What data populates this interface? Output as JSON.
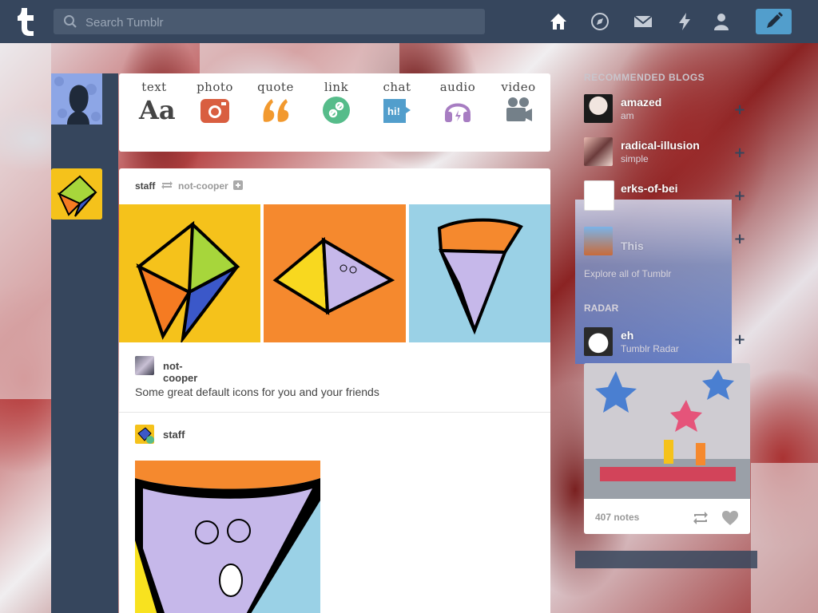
{
  "topbar": {
    "search_placeholder": "Search Tumblr",
    "icons": [
      "home-icon",
      "explore-icon",
      "inbox-icon",
      "activity-icon",
      "account-icon",
      "compose-icon"
    ]
  },
  "post_types": [
    {
      "label": "text",
      "glyph": "Aa",
      "color": "#444444"
    },
    {
      "label": "photo",
      "color": "#d95e40"
    },
    {
      "label": "quote",
      "glyph": "❝",
      "color": "#f2992e"
    },
    {
      "label": "link",
      "color": "#56bc8a"
    },
    {
      "label": "chat",
      "glyph": "hi!",
      "color": "#529ecc"
    },
    {
      "label": "audio",
      "color": "#a77dc2"
    },
    {
      "label": "video",
      "color": "#748089"
    }
  ],
  "post": {
    "author": "staff",
    "reblogged_from": "not-cooper",
    "reblog_user": "not-cooper",
    "text": "Some great default icons for you and your friends",
    "second_user": "staff"
  },
  "sidebar": {
    "recommended_title": "RECOMMENDED BLOGS",
    "blogs": [
      {
        "name": "amazed",
        "sub": "am"
      },
      {
        "name": "radical-illusion",
        "sub": "simple"
      },
      {
        "name": "erks-of-bei",
        "sub": ""
      },
      {
        "name": "This",
        "sub": ""
      }
    ],
    "explore_text": "Explore all of Tumblr",
    "radar_title": "RADAR",
    "radar_blog": {
      "name": "eh",
      "sub": "Tumblr Radar"
    },
    "radar_notes": "407 notes"
  },
  "colors": {
    "navy": "#36465d",
    "accent_blue": "#529ecc"
  }
}
